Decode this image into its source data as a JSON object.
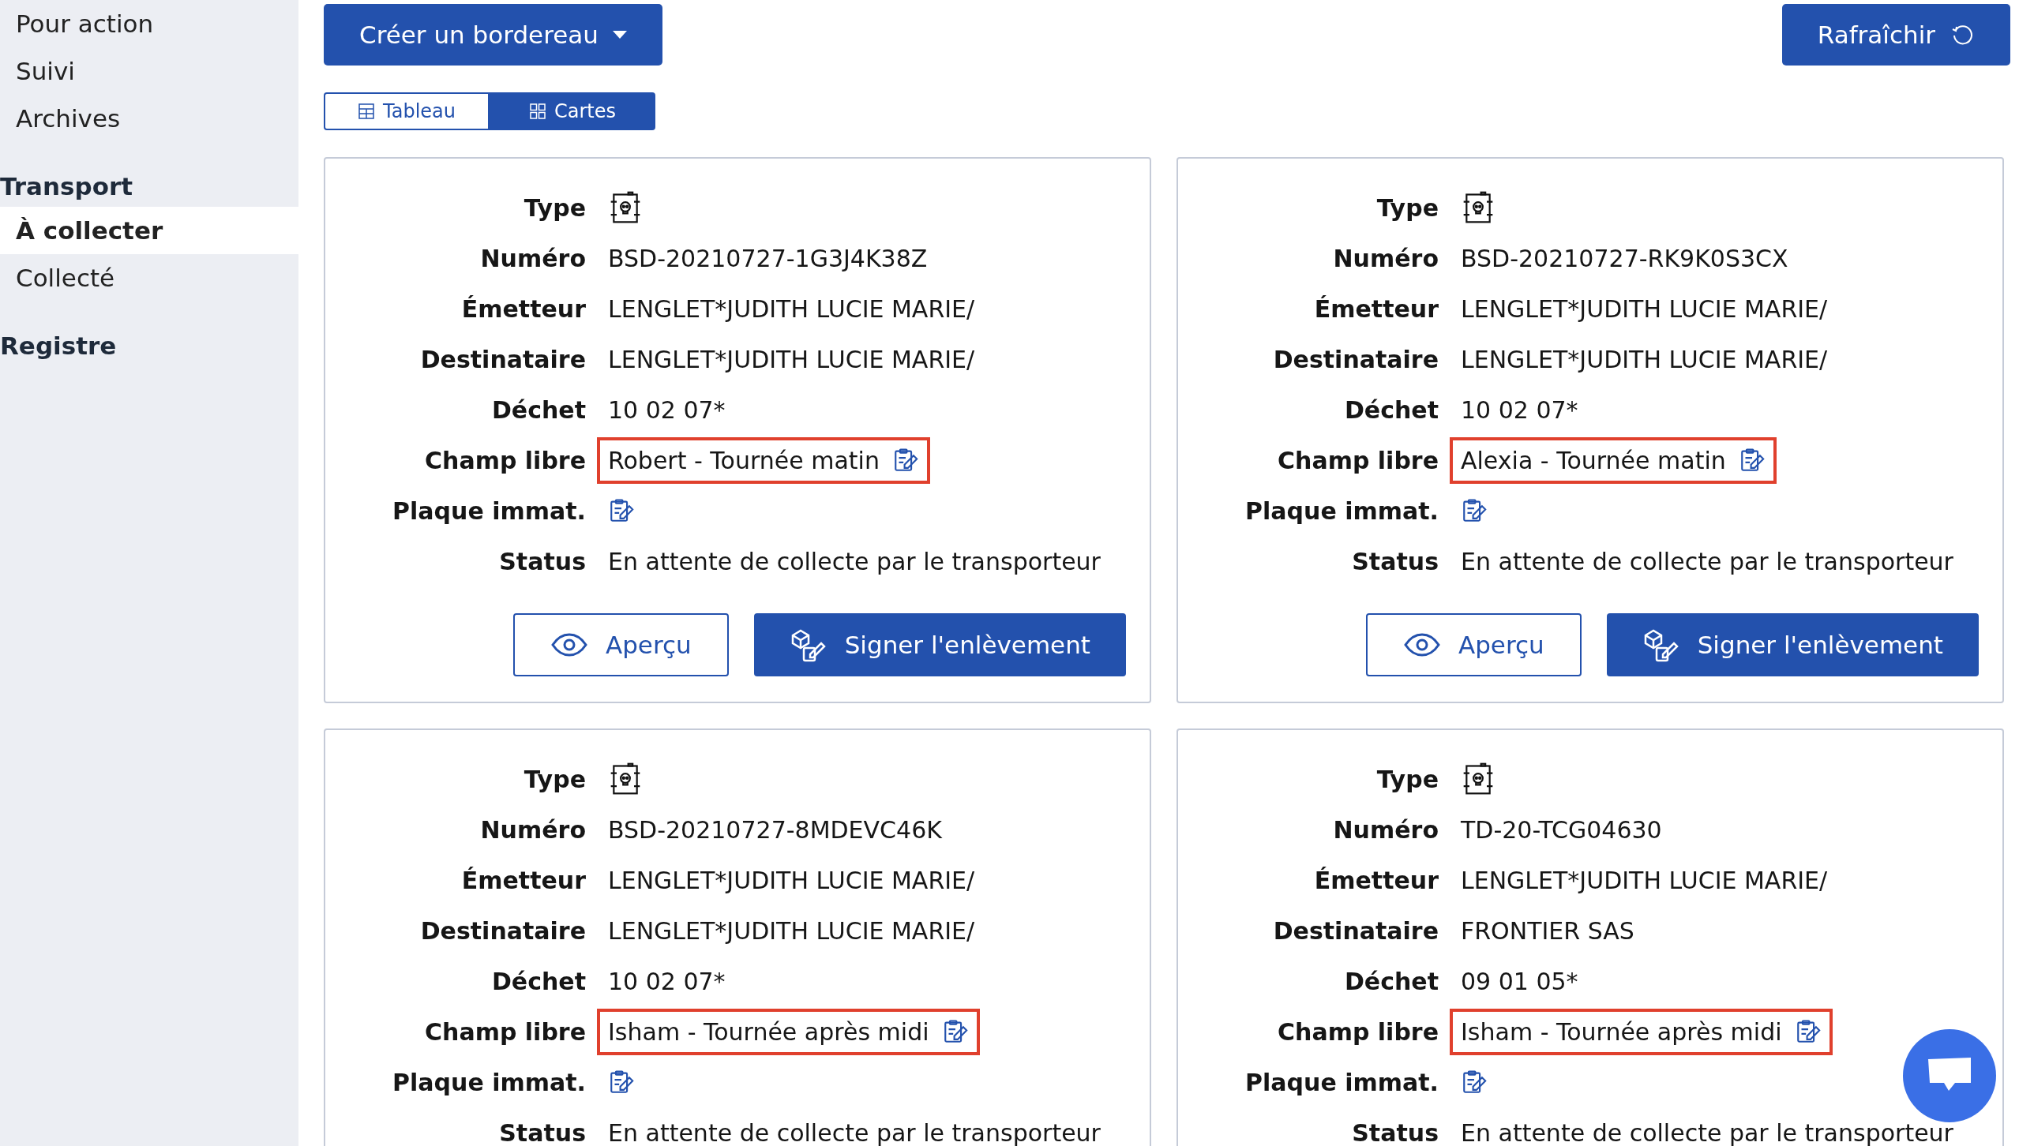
{
  "sidebar": {
    "groups": [
      {
        "items": [
          {
            "label": "Pour action",
            "selected": false
          },
          {
            "label": "Suivi",
            "selected": false
          },
          {
            "label": "Archives",
            "selected": false
          }
        ]
      },
      {
        "title": "Transport",
        "items": [
          {
            "label": "À collecter",
            "selected": true
          },
          {
            "label": "Collecté",
            "selected": false
          }
        ]
      },
      {
        "title": "Registre"
      }
    ]
  },
  "toolbar": {
    "create_button": "Créer un bordereau",
    "refresh_button": "Rafraîchir"
  },
  "view_toggle": [
    {
      "label": "Tableau",
      "kind": "table",
      "selected": false
    },
    {
      "label": "Cartes",
      "kind": "cards",
      "selected": true
    }
  ],
  "cards": [
    {
      "fields": [
        {
          "label": "Type",
          "kind": "icon"
        },
        {
          "label": "Numéro",
          "kind": "text",
          "value": "BSD-20210727-1G3J4K38Z"
        },
        {
          "label": "Émetteur",
          "kind": "text",
          "value": "LENGLET*JUDITH LUCIE MARIE/"
        },
        {
          "label": "Destinataire",
          "kind": "text",
          "value": "LENGLET*JUDITH LUCIE MARIE/"
        },
        {
          "label": "Déchet",
          "kind": "text",
          "value": "10 02 07*"
        },
        {
          "label": "Champ libre",
          "kind": "editable",
          "value": "Robert - Tournée matin",
          "highlighted": true
        },
        {
          "label": "Plaque immat.",
          "kind": "editable",
          "highlighted": false
        },
        {
          "label": "Status",
          "kind": "text",
          "value": "En attente de collecte par le transporteur"
        }
      ],
      "actions": [
        "Aperçu",
        "Signer l'enlèvement"
      ]
    },
    {
      "fields": [
        {
          "label": "Type",
          "kind": "icon"
        },
        {
          "label": "Numéro",
          "kind": "text",
          "value": "BSD-20210727-RK9K0S3CX"
        },
        {
          "label": "Émetteur",
          "kind": "text",
          "value": "LENGLET*JUDITH LUCIE MARIE/"
        },
        {
          "label": "Destinataire",
          "kind": "text",
          "value": "LENGLET*JUDITH LUCIE MARIE/"
        },
        {
          "label": "Déchet",
          "kind": "text",
          "value": "10 02 07*"
        },
        {
          "label": "Champ libre",
          "kind": "editable",
          "value": "Alexia - Tournée matin",
          "highlighted": true
        },
        {
          "label": "Plaque immat.",
          "kind": "editable",
          "highlighted": false
        },
        {
          "label": "Status",
          "kind": "text",
          "value": "En attente de collecte par le transporteur"
        }
      ],
      "actions": [
        "Aperçu",
        "Signer l'enlèvement"
      ]
    },
    {
      "fields": [
        {
          "label": "Type",
          "kind": "icon"
        },
        {
          "label": "Numéro",
          "kind": "text",
          "value": "BSD-20210727-8MDEVC46K"
        },
        {
          "label": "Émetteur",
          "kind": "text",
          "value": "LENGLET*JUDITH LUCIE MARIE/"
        },
        {
          "label": "Destinataire",
          "kind": "text",
          "value": "LENGLET*JUDITH LUCIE MARIE/"
        },
        {
          "label": "Déchet",
          "kind": "text",
          "value": "10 02 07*"
        },
        {
          "label": "Champ libre",
          "kind": "editable",
          "value": "Isham - Tournée après midi",
          "highlighted": true
        },
        {
          "label": "Plaque immat.",
          "kind": "editable",
          "highlighted": false
        },
        {
          "label": "Status",
          "kind": "text",
          "value": "En attente de collecte par le transporteur"
        }
      ]
    },
    {
      "fields": [
        {
          "label": "Type",
          "kind": "icon"
        },
        {
          "label": "Numéro",
          "kind": "text",
          "value": "TD-20-TCG04630"
        },
        {
          "label": "Émetteur",
          "kind": "text",
          "value": "LENGLET*JUDITH LUCIE MARIE/"
        },
        {
          "label": "Destinataire",
          "kind": "text",
          "value": "FRONTIER SAS"
        },
        {
          "label": "Déchet",
          "kind": "text",
          "value": "09 01 05*"
        },
        {
          "label": "Champ libre",
          "kind": "editable",
          "value": "Isham - Tournée après midi",
          "highlighted": true
        },
        {
          "label": "Plaque immat.",
          "kind": "editable",
          "highlighted": false
        },
        {
          "label": "Status",
          "kind": "text",
          "value": "En attente de collecte par le transporteur"
        }
      ]
    }
  ]
}
